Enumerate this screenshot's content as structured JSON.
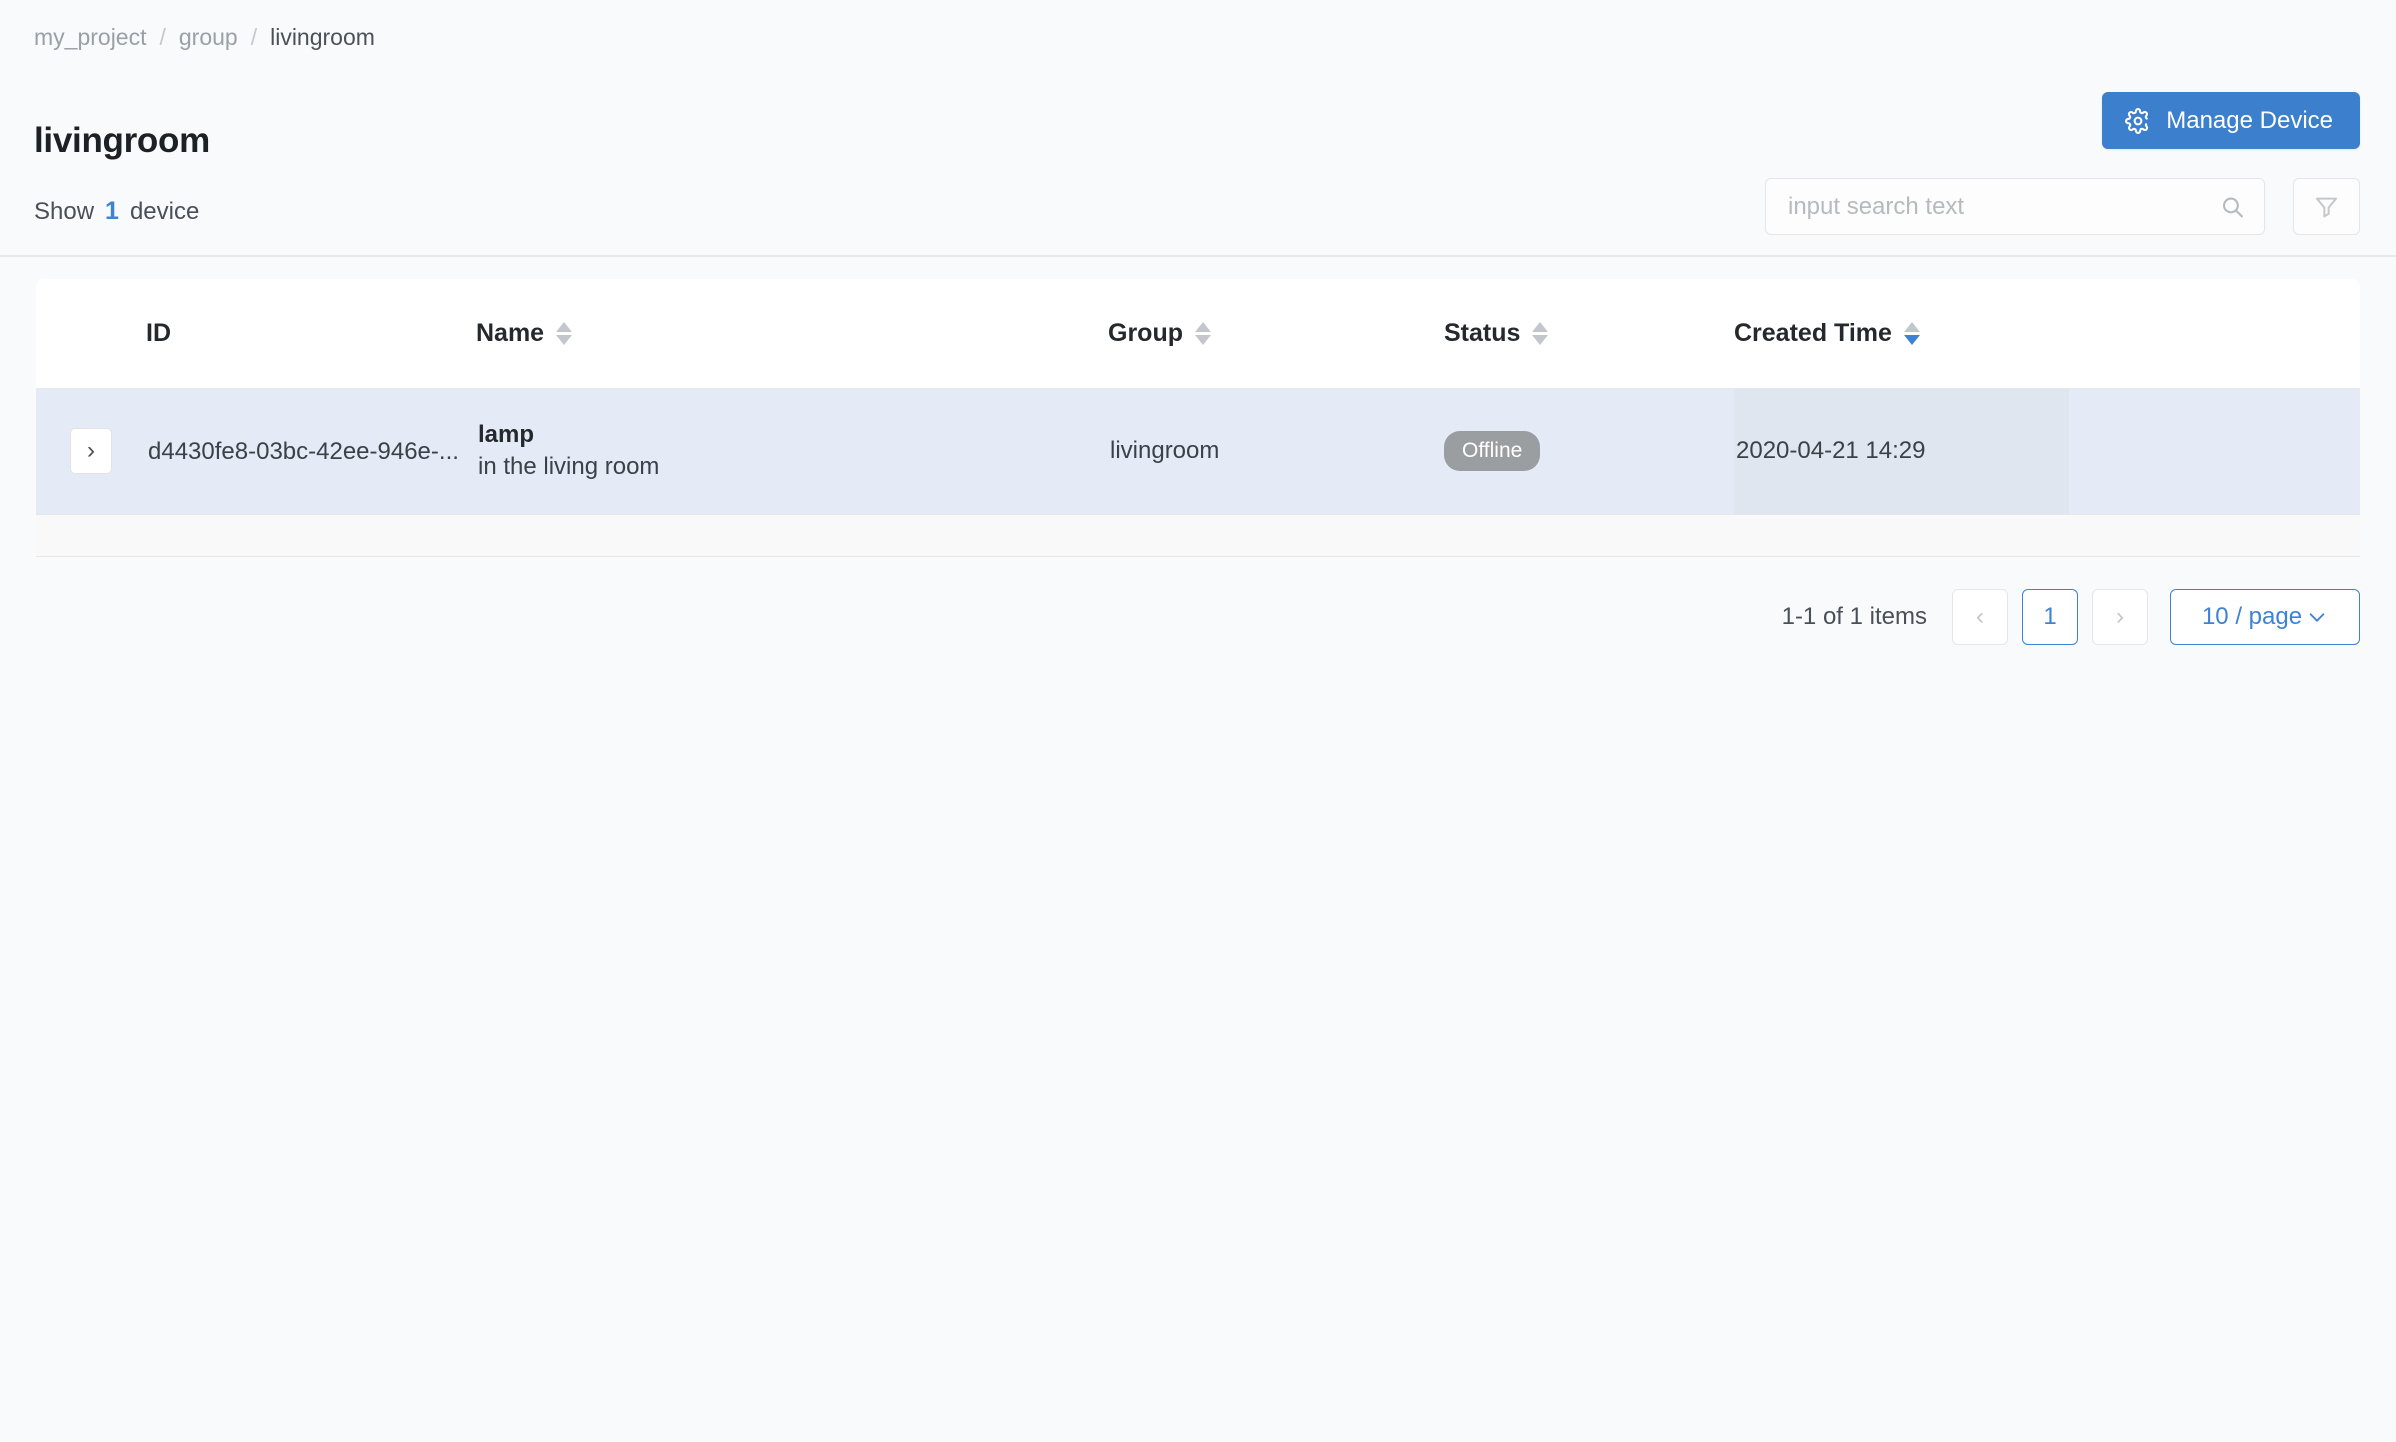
{
  "breadcrumb": {
    "separator": "/",
    "items": [
      {
        "label": "my_project"
      },
      {
        "label": "group"
      },
      {
        "label": "livingroom"
      }
    ]
  },
  "header": {
    "title": "livingroom",
    "manage_button": {
      "label": "Manage Device",
      "icon": "gear-icon",
      "bg": "#3c7fcc"
    }
  },
  "summary": {
    "prefix": "Show",
    "count": "1",
    "suffix": "device",
    "count_color": "#3e82d6"
  },
  "search": {
    "placeholder": "input search text",
    "value": "",
    "icon": "search-icon"
  },
  "filter": {
    "icon": "funnel-icon",
    "label": ""
  },
  "table": {
    "columns": [
      {
        "key": "expand",
        "label": "",
        "sortable": false
      },
      {
        "key": "id",
        "label": "ID",
        "sortable": false
      },
      {
        "key": "name",
        "label": "Name",
        "sortable": true,
        "sort": "none"
      },
      {
        "key": "group",
        "label": "Group",
        "sortable": true,
        "sort": "none"
      },
      {
        "key": "status",
        "label": "Status",
        "sortable": true,
        "sort": "none"
      },
      {
        "key": "created_time",
        "label": "Created Time",
        "sortable": true,
        "sort": "desc"
      }
    ],
    "rows": [
      {
        "expand_icon": "chevron-right-icon",
        "id": "d4430fe8-03bc-42ee-946e-...",
        "name": "lamp",
        "description": "in the living room",
        "group": "livingroom",
        "status": "Offline",
        "status_color": "#9b9ea1",
        "created_time": "2020-04-21 14:29"
      }
    ]
  },
  "pagination": {
    "total_text": "1-1 of 1 items",
    "prev_label": "‹",
    "next_label": "›",
    "current_page": "1",
    "page_size_label": "10 / page"
  }
}
